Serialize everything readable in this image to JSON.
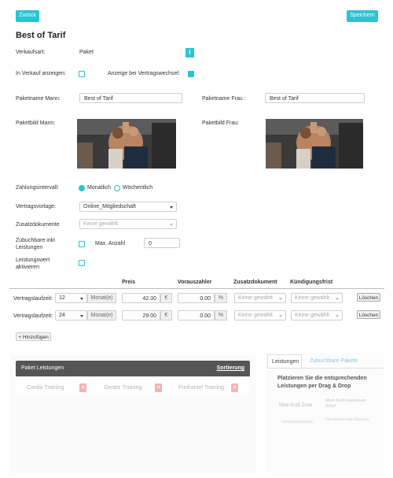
{
  "toolbar": {
    "back_label": "Zurück",
    "save_label": "Speichern"
  },
  "page": {
    "title": "Best of Tarif"
  },
  "sales_type": {
    "label": "Verkaufsart:",
    "value": "Paket"
  },
  "show_in_sales": {
    "label": "In Verkauf anzeigen:",
    "checked": false
  },
  "show_on_contract_change": {
    "label": "Anzeige bei Vertragswechsel:",
    "checked": true
  },
  "package_name_male": {
    "label": "Paketname Mann:",
    "value": "Best of Tarif"
  },
  "package_name_female": {
    "label": "Paketname Frau :",
    "value": "Best of Tarif"
  },
  "package_image_male": {
    "label": "Paketbild Mann:"
  },
  "package_image_female": {
    "label": "Paketbild Frau:"
  },
  "payment_interval": {
    "label": "Zahlungsintervall:",
    "options": [
      "Monatlich",
      "Wöchentlich"
    ],
    "selected": "Monatlich"
  },
  "contract_template": {
    "label": "Vertragsvorlage:",
    "value": "Online_Mitgliedschaft"
  },
  "additional_docs": {
    "label": "Zusatzdokumente",
    "placeholder": "Keine gewählt"
  },
  "bookable_incl": {
    "label_line1": "Zubuchbare inkl",
    "label_line2": "Leistungen",
    "checked": false,
    "max_label": "Max. Anzahl",
    "max_value": "0"
  },
  "service_value": {
    "label_line1": "Leistungswert",
    "label_line2": "aktivieren",
    "checked": false
  },
  "terms_table": {
    "headers": {
      "price": "Preis",
      "prepayer": "Vorauszahler",
      "extra_doc": "Zusatzdokument",
      "cancellation": "Kündigungsfrist"
    },
    "rows": [
      {
        "label": "Vertragslaufzeit:",
        "term": "12",
        "unit": "Monat(e)",
        "price": "42.00",
        "currency": "€",
        "prepay": "0.00",
        "percent": "%",
        "doc": "Keine gewählt",
        "cancel": "Keine gewählt",
        "delete_label": "Löschen"
      },
      {
        "label": "Vertragslaufzeit:",
        "term": "24",
        "unit": "Monat(e)",
        "price": "29.00",
        "currency": "€",
        "prepay": "0.00",
        "percent": "%",
        "doc": "Keine gewählt",
        "cancel": "Keine gewählt",
        "delete_label": "Löschen"
      }
    ],
    "add_label": "+ Hinzufügen"
  },
  "package_services": {
    "title": "Paket Leistungen",
    "sort_label": "Sortierung",
    "items": [
      "Cardio Training",
      "Geräte Training",
      "Freihantel Training"
    ]
  },
  "side_panel": {
    "tabs": [
      "Leistungen",
      "Zubuchbare Pakete"
    ],
    "active_tab": "Leistungen",
    "instruction": "Platzieren Sie die entsprechenden Leistungen per Drag & Drop",
    "items": [
      "Maxi Kraft Zone",
      "Mein Kraft-/ausdauer Zirkel",
      "",
      "Gerätetraining Ranque"
    ]
  },
  "colors": {
    "accent": "#2bc4d2",
    "panel_header": "#555555",
    "delete_x": "#f4a7a7"
  }
}
